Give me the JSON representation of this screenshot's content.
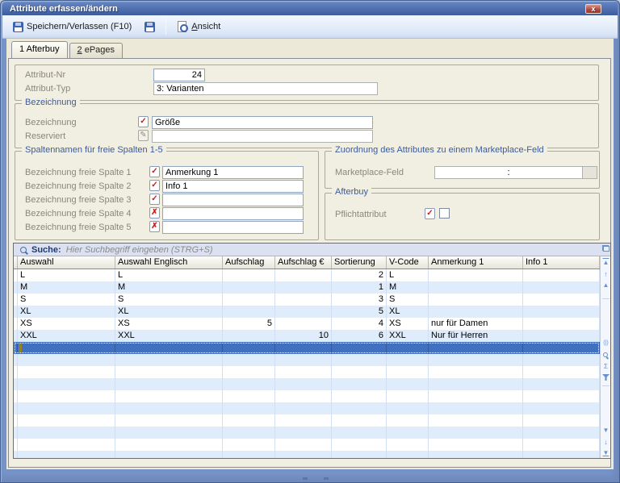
{
  "window": {
    "title": "Attribute erfassen/ändern"
  },
  "toolbar": {
    "save_exit_label": "Speichern/Verlassen (F10)",
    "ansicht_label": "Ansicht"
  },
  "tabs": [
    {
      "label": "1 Afterbuy"
    },
    {
      "label": "2 ePages"
    }
  ],
  "form": {
    "attribut_nr": {
      "label": "Attribut-Nr",
      "value": "24"
    },
    "attribut_typ": {
      "label": "Attribut-Typ",
      "value": "3: Varianten"
    },
    "groups": {
      "bezeichnung": "Bezeichnung",
      "spalten": "Spaltennamen für freie Spalten 1-5",
      "marketplace": "Zuordnung des Attributes zu einem Marketplace-Feld",
      "afterbuy": "Afterbuy"
    },
    "bezeichnung": {
      "label": "Bezeichnung",
      "value": "Größe"
    },
    "reserviert": {
      "label": "Reserviert",
      "value": ""
    },
    "spalten": [
      {
        "label": "Bezeichnung freie Spalte 1",
        "value": "Anmerkung 1"
      },
      {
        "label": "Bezeichnung freie Spalte 2",
        "value": "Info 1"
      },
      {
        "label": "Bezeichnung freie Spalte 3",
        "value": ""
      },
      {
        "label": "Bezeichnung freie Spalte 4",
        "value": ""
      },
      {
        "label": "Bezeichnung freie Spalte 5",
        "value": ""
      }
    ],
    "marketplace": {
      "label": "Marketplace-Feld",
      "value": ":"
    },
    "pflicht": {
      "label": "Pflichtattribut",
      "checked": false
    }
  },
  "grid": {
    "search_label": "Suche:",
    "search_placeholder": "Hier Suchbegriff eingeben (STRG+S)",
    "columns": [
      "Auswahl",
      "Auswahl Englisch",
      "Aufschlag",
      "Aufschlag €",
      "Sortierung",
      "V-Code",
      "Anmerkung 1",
      "Info 1"
    ],
    "rows": [
      [
        "L",
        "L",
        "",
        "",
        "2",
        "L",
        "",
        ""
      ],
      [
        "M",
        "M",
        "",
        "",
        "1",
        "M",
        "",
        ""
      ],
      [
        "S",
        "S",
        "",
        "",
        "3",
        "S",
        "",
        ""
      ],
      [
        "XL",
        "XL",
        "",
        "",
        "5",
        "XL",
        "",
        ""
      ],
      [
        "XS",
        "XS",
        "5",
        "",
        "4",
        "XS",
        "nur für Damen",
        ""
      ],
      [
        "XXL",
        "XXL",
        "",
        "10",
        "6",
        "XXL",
        "Nur für Herren",
        ""
      ]
    ]
  },
  "icons": {
    "close": "x",
    "check": "✓",
    "cross": "✗",
    "pencil": "✎",
    "sum": "Σ",
    "up_arrow": "↑",
    "down_arrow": "↓",
    "up_tri": "▲",
    "down_tri": "▼",
    "paren": "(|)"
  }
}
